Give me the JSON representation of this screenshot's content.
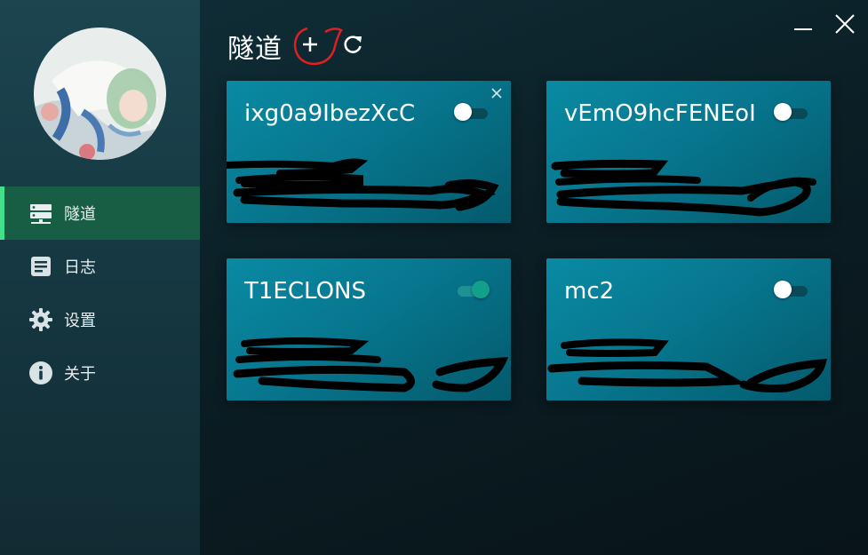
{
  "nav": {
    "items": [
      {
        "label": "隧道",
        "icon": "server-icon",
        "active": true
      },
      {
        "label": "日志",
        "icon": "log-icon",
        "active": false
      },
      {
        "label": "设置",
        "icon": "gear-icon",
        "active": false
      },
      {
        "label": "关于",
        "icon": "info-icon",
        "active": false
      }
    ]
  },
  "header": {
    "title": "隧道",
    "add_icon": "plus-icon",
    "refresh_icon": "refresh-icon"
  },
  "tunnels": [
    {
      "name": "ixg0a9IbezXcC",
      "enabled": false,
      "closable": true
    },
    {
      "name": "vEmO9hcFENEoI",
      "enabled": false,
      "closable": false
    },
    {
      "name": "T1ECLONS",
      "enabled": true,
      "closable": false
    },
    {
      "name": "mc2",
      "enabled": false,
      "closable": false
    }
  ],
  "colors": {
    "accent": "#42e08d",
    "active_nav_bg": "#185e45",
    "card_bg": "#0a8aa3",
    "toggle_on": "#12a08a",
    "annotation_red": "#e02020"
  }
}
